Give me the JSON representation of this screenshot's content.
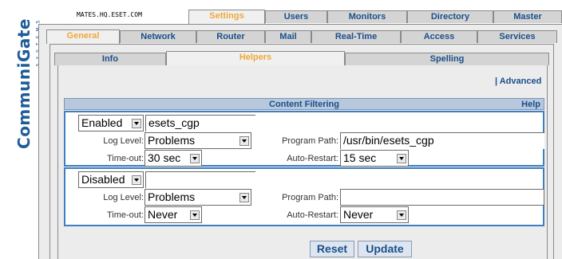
{
  "logo": {
    "word": "CommuniGate",
    "sub": "SYSTEMS"
  },
  "header": {
    "host": "MATES.HQ.ESET.COM"
  },
  "top_tabs": [
    "Settings",
    "Users",
    "Monitors",
    "Directory",
    "Master"
  ],
  "sub_tabs": [
    "General",
    "Network",
    "Router",
    "Mail",
    "Real-Time",
    "Access",
    "Services"
  ],
  "third_tabs": [
    "Info",
    "Helpers",
    "Spelling"
  ],
  "advanced_link": "| Advanced",
  "filtering": {
    "title": "Content Filtering",
    "help": "Help",
    "labels": {
      "log_level": "Log Level:",
      "timeout": "Time-out:",
      "program_path": "Program Path:",
      "auto_restart": "Auto-Restart:"
    },
    "rows": [
      {
        "state": "Enabled",
        "name": "esets_cgp",
        "log_level": "Problems",
        "program_path": "/usr/bin/esets_cgp",
        "timeout": "30 sec",
        "auto_restart": "15 sec"
      },
      {
        "state": "Disabled",
        "name": "",
        "log_level": "Problems",
        "program_path": "",
        "timeout": "Never",
        "auto_restart": "Never"
      }
    ]
  },
  "buttons": {
    "reset": "Reset",
    "update": "Update"
  }
}
